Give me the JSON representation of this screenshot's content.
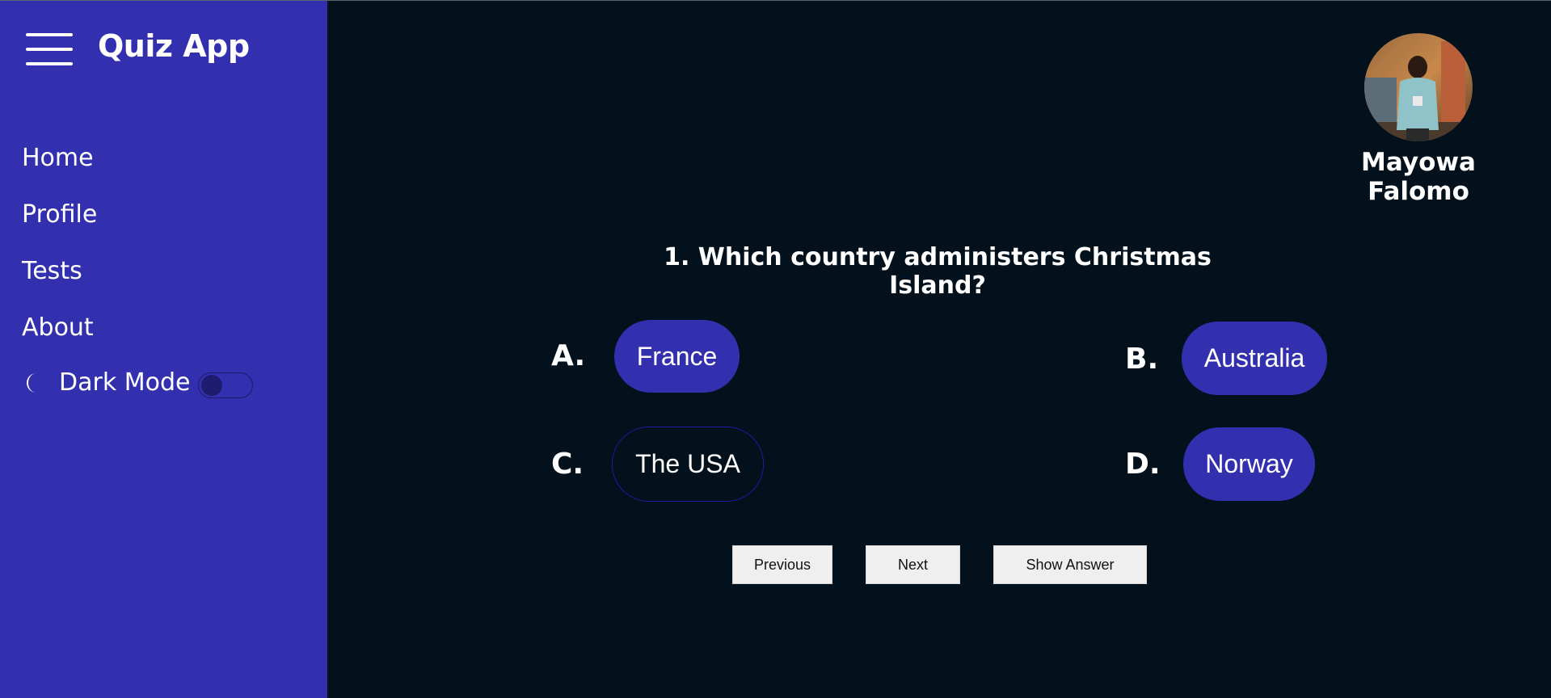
{
  "app": {
    "title": "Quiz App"
  },
  "sidebar": {
    "items": [
      {
        "label": "Home"
      },
      {
        "label": "Profile"
      },
      {
        "label": "Tests"
      },
      {
        "label": "About"
      }
    ],
    "dark_mode": {
      "label": "Dark Mode",
      "enabled": false,
      "icon": "moon-icon"
    }
  },
  "user": {
    "name": "Mayowa Falomo"
  },
  "quiz": {
    "question": "1. Which country administers Christmas Island?",
    "options": [
      {
        "letter": "A.",
        "text": "France"
      },
      {
        "letter": "B.",
        "text": "Australia"
      },
      {
        "letter": "C.",
        "text": "The USA"
      },
      {
        "letter": "D.",
        "text": "Norway"
      }
    ]
  },
  "buttons": {
    "previous": "Previous",
    "next": "Next",
    "show_answer": "Show Answer"
  },
  "colors": {
    "sidebar": "#3330b0",
    "background": "#02111b",
    "option": "#3330b0",
    "option_outline": "#1f1aa8"
  }
}
